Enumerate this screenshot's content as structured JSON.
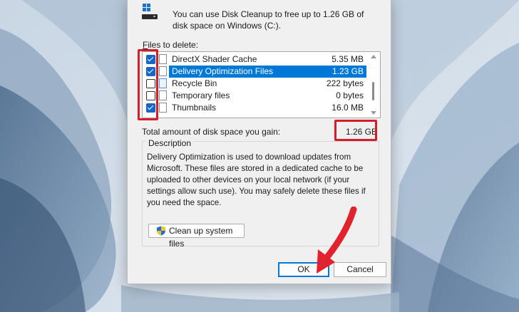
{
  "dialog": {
    "intro_text": "You can use Disk Cleanup to free up to 1.26 GB of disk space on Windows (C:).",
    "files_label_underlined": "F",
    "files_label_rest": "iles to delete:",
    "files": [
      {
        "name": "DirectX Shader Cache",
        "size": "5.35 MB",
        "checked": true,
        "icon": "file-icon"
      },
      {
        "name": "Delivery Optimization Files",
        "size": "1.23 GB",
        "checked": true,
        "icon": "file-icon",
        "selected": true
      },
      {
        "name": "Recycle Bin",
        "size": "222 bytes",
        "checked": false,
        "icon": "recycle-bin-icon"
      },
      {
        "name": "Temporary files",
        "size": "0 bytes",
        "checked": false,
        "icon": "file-icon"
      },
      {
        "name": "Thumbnails",
        "size": "16.0 MB",
        "checked": true,
        "icon": "file-icon"
      }
    ],
    "total_label": "Total amount of disk space you gain:",
    "total_value": "1.26 GB",
    "description_title": "Description",
    "description_text": "Delivery Optimization is used to download updates from Microsoft. These files are stored in a dedicated cache to be uploaded to other devices on your local network (if your settings allow such use). You may safely delete these files if you need the space.",
    "cleanup_button": "Clean up system files",
    "ok_button": "OK",
    "cancel_button": "Cancel"
  },
  "colors": {
    "accent": "#0078d7",
    "highlight_red": "#d41e2a",
    "dialog_bg": "#f0f0f0"
  }
}
